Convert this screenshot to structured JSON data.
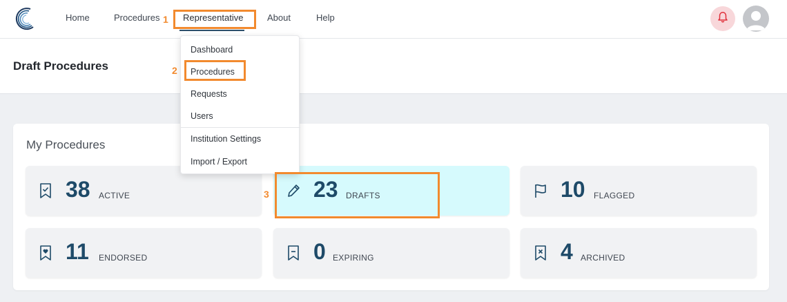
{
  "nav": {
    "home": "Home",
    "procedures": "Procedures",
    "representative": "Representative",
    "about": "About",
    "help": "Help"
  },
  "icons": {
    "logo": "crescent-logo-icon",
    "bell": "bell-icon",
    "avatar": "user-avatar-icon"
  },
  "colors": {
    "accent": "#1e4a68",
    "highlight": "#d6fafd",
    "annotation": "#f28a2e",
    "bell_bg": "#f8d7da",
    "bell_icon": "#e0303b"
  },
  "page": {
    "title": "Draft Procedures"
  },
  "card": {
    "title": "My Procedures"
  },
  "tiles": [
    {
      "count": "38",
      "label": "ACTIVE",
      "icon": "bookmark-check-icon"
    },
    {
      "count": "23",
      "label": "DRAFTS",
      "icon": "pencil-icon",
      "highlighted": true
    },
    {
      "count": "10",
      "label": "FLAGGED",
      "icon": "flag-icon"
    },
    {
      "count": "11",
      "label": "ENDORSED",
      "icon": "bookmark-heart-icon"
    },
    {
      "count": "0",
      "label": "EXPIRING",
      "icon": "bookmark-minus-icon"
    },
    {
      "count": "4",
      "label": "ARCHIVED",
      "icon": "bookmark-x-icon"
    }
  ],
  "dropdown": {
    "items": [
      "Dashboard",
      "Procedures",
      "Requests",
      "Users",
      "Institution Settings",
      "Import / Export"
    ]
  },
  "annotations": [
    "1",
    "2",
    "3"
  ]
}
